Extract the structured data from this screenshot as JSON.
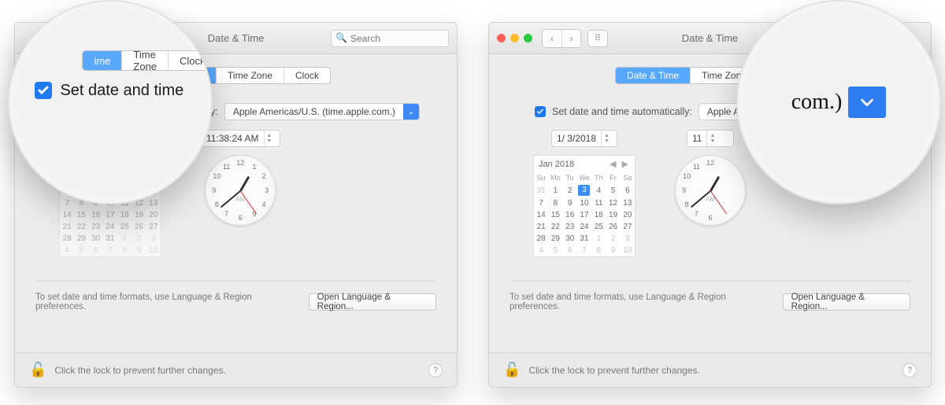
{
  "title": "Date & Time",
  "search_placeholder": "Search",
  "tabs": {
    "t0": "Date & Time",
    "t1": "Time Zone",
    "t2": "Clock"
  },
  "auto_label_full": "Set date and time automatically:",
  "auto_checked": true,
  "server_value": "Apple Americas/U.S. (time.apple.com.)",
  "server_value_short": "Apple Americas/U",
  "date_value": "1/  3/2018",
  "time_value": "11:38:24 AM",
  "calendar": {
    "month": "Jan 2018",
    "dow": [
      "Su",
      "Mo",
      "Tu",
      "We",
      "Th",
      "Fr",
      "Sa"
    ],
    "leading": [
      "31",
      "1",
      "2",
      "3",
      "4",
      "5",
      "6"
    ],
    "rows": [
      [
        "7",
        "8",
        "9",
        "10",
        "11",
        "12",
        "13"
      ],
      [
        "14",
        "15",
        "16",
        "17",
        "18",
        "19",
        "20"
      ],
      [
        "21",
        "22",
        "23",
        "24",
        "25",
        "26",
        "27"
      ],
      [
        "28",
        "29",
        "30",
        "31",
        "1",
        "2",
        "3"
      ],
      [
        "4",
        "5",
        "6",
        "7",
        "8",
        "9",
        "10"
      ]
    ],
    "selected": "3"
  },
  "clock_label": "AM",
  "format_hint": "To set date and time formats, use Language & Region preferences.",
  "open_lang_btn": "Open Language & Region...",
  "lock_text": "Click the lock to prevent further changes.",
  "mag1_label": "Set date and time",
  "mag2_text": "com.)"
}
